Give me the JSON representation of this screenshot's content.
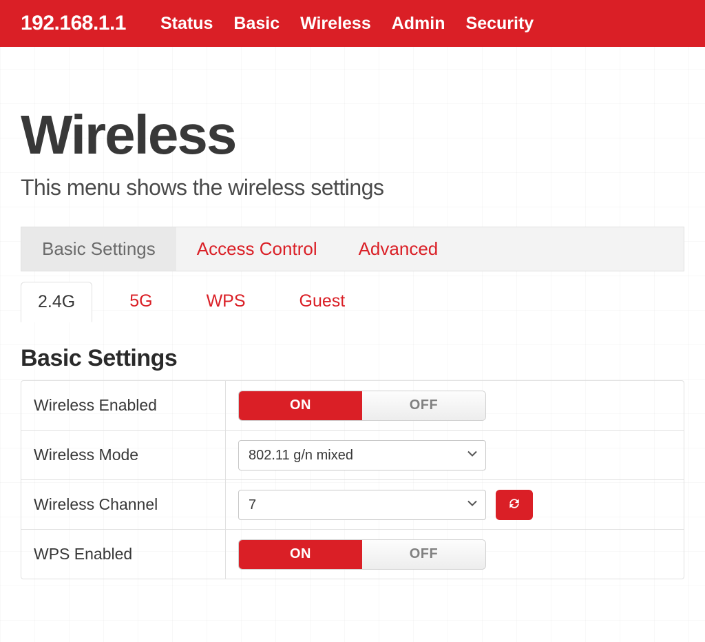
{
  "brand": "192.168.1.1",
  "nav": [
    "Status",
    "Basic",
    "Wireless",
    "Admin",
    "Security"
  ],
  "page": {
    "title": "Wireless",
    "subtitle": "This menu shows the wireless settings"
  },
  "tabs_primary": [
    {
      "label": "Basic Settings",
      "active": true
    },
    {
      "label": "Access Control",
      "active": false
    },
    {
      "label": "Advanced",
      "active": false
    }
  ],
  "tabs_secondary": [
    {
      "label": "2.4G",
      "active": true
    },
    {
      "label": "5G",
      "active": false
    },
    {
      "label": "WPS",
      "active": false
    },
    {
      "label": "Guest",
      "active": false
    }
  ],
  "section_title": "Basic Settings",
  "settings": {
    "wireless_enabled": {
      "label": "Wireless Enabled",
      "on": "ON",
      "off": "OFF",
      "value": "ON"
    },
    "wireless_mode": {
      "label": "Wireless Mode",
      "value": "802.11 g/n mixed"
    },
    "wireless_channel": {
      "label": "Wireless Channel",
      "value": "7"
    },
    "wps_enabled": {
      "label": "WPS Enabled",
      "on": "ON",
      "off": "OFF",
      "value": "ON"
    }
  },
  "colors": {
    "accent": "#da1f26"
  }
}
